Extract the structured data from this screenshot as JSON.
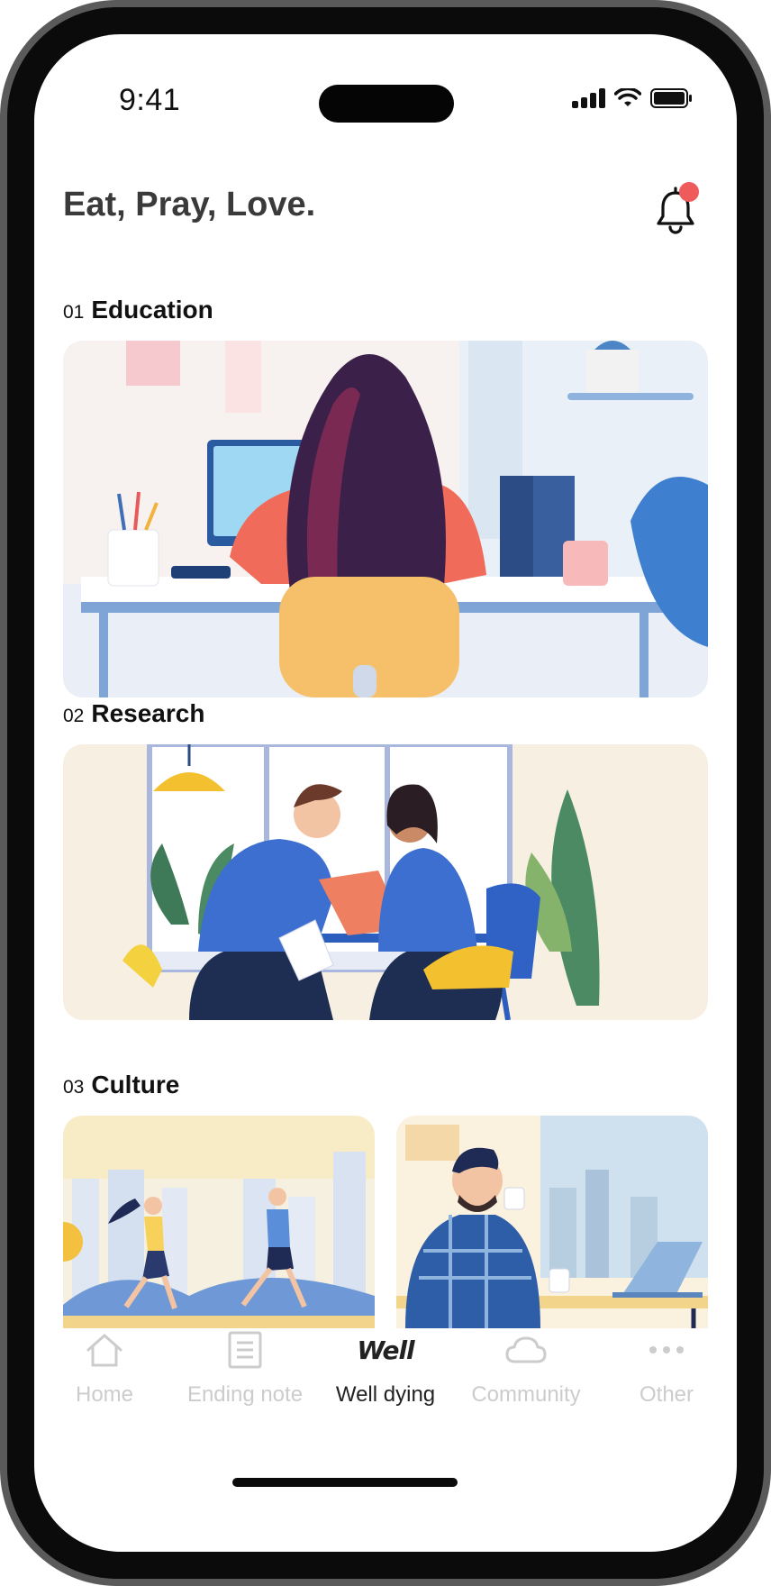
{
  "status_bar": {
    "time": "9:41"
  },
  "header": {
    "title": "Eat, Pray, Love.",
    "notification_icon": "bell-icon",
    "has_unread": true,
    "badge_color": "#ef5a5a"
  },
  "sections": [
    {
      "number": "01",
      "title": "Education",
      "image": "woman-at-desk-illustration"
    },
    {
      "number": "02",
      "title": "Research",
      "image": "two-people-working-at-table-illustration"
    },
    {
      "number": "03",
      "title": "Culture",
      "images": [
        "runners-in-city-illustration",
        "man-with-coffee-and-laptop-illustration"
      ]
    }
  ],
  "tabbar": {
    "active_index": 2,
    "items": [
      {
        "label": "Home",
        "icon": "home-icon"
      },
      {
        "label": "Ending note",
        "icon": "note-icon"
      },
      {
        "label": "Well dying",
        "icon": "well-logo",
        "logo_text": "Well"
      },
      {
        "label": "Community",
        "icon": "cloud-icon"
      },
      {
        "label": "Other",
        "icon": "more-icon"
      }
    ]
  },
  "colors": {
    "active_tab": "#222222",
    "inactive_tab": "#cccccc",
    "title": "#3a3a3a"
  }
}
